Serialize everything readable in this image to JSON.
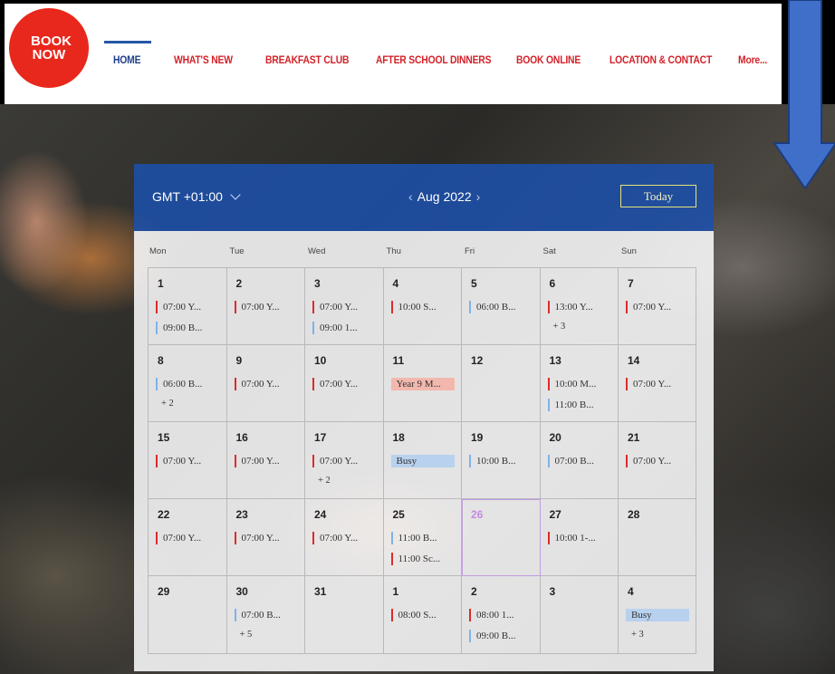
{
  "header": {
    "badge": "BOOK NOW",
    "nav": [
      "HOME",
      "WHAT'S NEW",
      "BREAKFAST CLUB",
      "AFTER SCHOOL DINNERS",
      "BOOK ONLINE",
      "LOCATION & CONTACT",
      "More..."
    ],
    "active": "HOME"
  },
  "calendar": {
    "timezone": "GMT +01:00",
    "month": "Aug 2022",
    "today_label": "Today",
    "days_of_week": [
      "Mon",
      "Tue",
      "Wed",
      "Thu",
      "Fri",
      "Sat",
      "Sun"
    ],
    "weeks": [
      [
        {
          "day": "1",
          "events": [
            {
              "t": "07:00 Y...",
              "c": "red"
            },
            {
              "t": "09:00 B...",
              "c": "blue"
            }
          ]
        },
        {
          "day": "2",
          "events": [
            {
              "t": "07:00 Y...",
              "c": "red"
            }
          ]
        },
        {
          "day": "3",
          "events": [
            {
              "t": "07:00 Y...",
              "c": "red"
            },
            {
              "t": "09:00 1...",
              "c": "blue"
            }
          ]
        },
        {
          "day": "4",
          "events": [
            {
              "t": "10:00 S...",
              "c": "red"
            }
          ]
        },
        {
          "day": "5",
          "events": [
            {
              "t": "06:00 B...",
              "c": "blue"
            }
          ]
        },
        {
          "day": "6",
          "events": [
            {
              "t": "13:00 Y...",
              "c": "red"
            }
          ],
          "more": "+ 3"
        },
        {
          "day": "7",
          "events": [
            {
              "t": "07:00 Y...",
              "c": "red"
            }
          ]
        }
      ],
      [
        {
          "day": "8",
          "events": [
            {
              "t": "06:00 B...",
              "c": "blue"
            }
          ],
          "more": "+ 2"
        },
        {
          "day": "9",
          "events": [
            {
              "t": "07:00 Y...",
              "c": "red"
            }
          ]
        },
        {
          "day": "10",
          "events": [
            {
              "t": "07:00 Y...",
              "c": "red"
            }
          ]
        },
        {
          "day": "11",
          "events": [
            {
              "t": "Year 9 M...",
              "c": "pinkfill"
            }
          ]
        },
        {
          "day": "12",
          "events": []
        },
        {
          "day": "13",
          "events": [
            {
              "t": "10:00 M...",
              "c": "red"
            },
            {
              "t": "11:00 B...",
              "c": "blue"
            }
          ]
        },
        {
          "day": "14",
          "events": [
            {
              "t": "07:00 Y...",
              "c": "red"
            }
          ]
        }
      ],
      [
        {
          "day": "15",
          "events": [
            {
              "t": "07:00 Y...",
              "c": "red"
            }
          ]
        },
        {
          "day": "16",
          "events": [
            {
              "t": "07:00 Y...",
              "c": "red"
            }
          ]
        },
        {
          "day": "17",
          "events": [
            {
              "t": "07:00 Y...",
              "c": "red"
            }
          ],
          "more": "+ 2"
        },
        {
          "day": "18",
          "events": [
            {
              "t": "Busy",
              "c": "bluefill"
            }
          ]
        },
        {
          "day": "19",
          "events": [
            {
              "t": "10:00 B...",
              "c": "blue"
            }
          ]
        },
        {
          "day": "20",
          "events": [
            {
              "t": "07:00 B...",
              "c": "blue"
            }
          ]
        },
        {
          "day": "21",
          "events": [
            {
              "t": "07:00 Y...",
              "c": "red"
            }
          ]
        }
      ],
      [
        {
          "day": "22",
          "events": [
            {
              "t": "07:00 Y...",
              "c": "red"
            }
          ]
        },
        {
          "day": "23",
          "events": [
            {
              "t": "07:00 Y...",
              "c": "red"
            }
          ]
        },
        {
          "day": "24",
          "events": [
            {
              "t": "07:00 Y...",
              "c": "red"
            }
          ]
        },
        {
          "day": "25",
          "events": [
            {
              "t": "11:00 B...",
              "c": "blue"
            },
            {
              "t": "11:00 Sc...",
              "c": "red"
            }
          ]
        },
        {
          "day": "26",
          "events": [],
          "today": true
        },
        {
          "day": "27",
          "events": [
            {
              "t": "10:00 1-...",
              "c": "red"
            }
          ]
        },
        {
          "day": "28",
          "events": []
        }
      ],
      [
        {
          "day": "29",
          "events": []
        },
        {
          "day": "30",
          "events": [
            {
              "t": "07:00 B...",
              "c": "blue"
            }
          ],
          "more": "+ 5"
        },
        {
          "day": "31",
          "events": []
        },
        {
          "day": "1",
          "events": [
            {
              "t": "08:00 S...",
              "c": "red"
            }
          ]
        },
        {
          "day": "2",
          "events": [
            {
              "t": "08:00 1...",
              "c": "red"
            },
            {
              "t": "09:00 B...",
              "c": "blue"
            }
          ]
        },
        {
          "day": "3",
          "events": []
        },
        {
          "day": "4",
          "events": [
            {
              "t": "Busy",
              "c": "bluefill"
            }
          ],
          "more": "+ 3"
        }
      ]
    ]
  },
  "colors": {
    "brand_red": "#e8281c",
    "nav_red": "#d3222a",
    "calendar_blue": "#1c50aa",
    "arrow_blue": "#3f6fc9",
    "today_purple": "#c58ae3"
  }
}
